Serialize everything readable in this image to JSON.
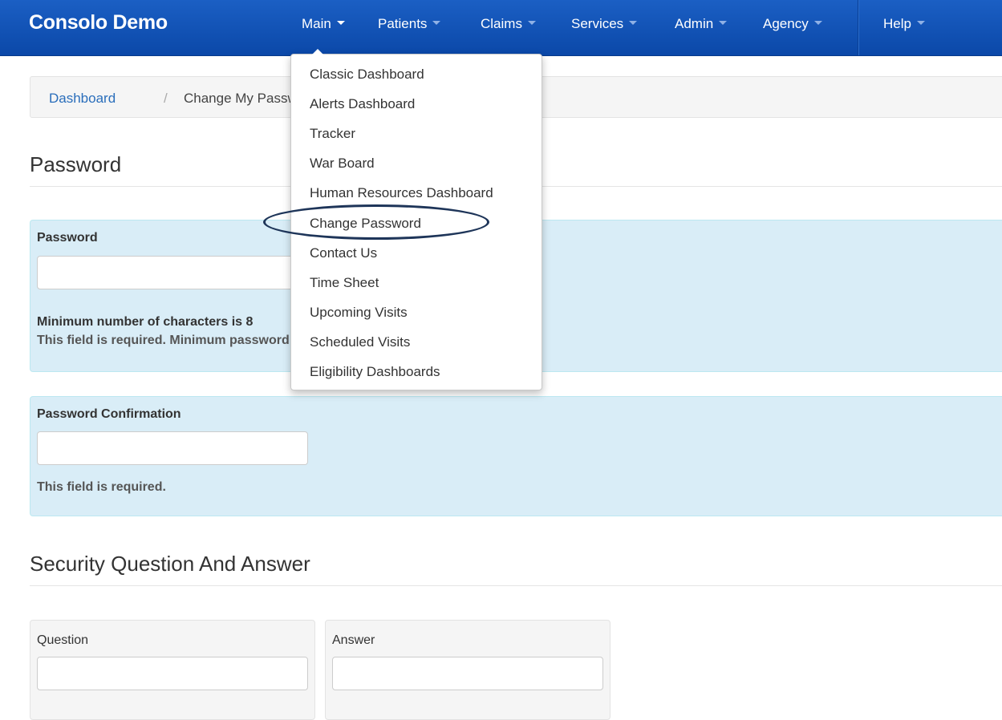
{
  "brand": "Consolo Demo",
  "nav": [
    {
      "label": "Main",
      "active": true
    },
    {
      "label": "Patients"
    },
    {
      "label": "Claims"
    },
    {
      "label": "Services"
    },
    {
      "label": "Admin"
    },
    {
      "label": "Agency"
    },
    {
      "label": "Help"
    }
  ],
  "breadcrumb": {
    "link": "Dashboard",
    "separator": "/",
    "current": "Change My Password"
  },
  "password_section": {
    "title": "Password"
  },
  "password_panel": {
    "label": "Password",
    "help_1": "Minimum number of characters is 8",
    "help_2": "This field is required. Minimum password length is 8 characters."
  },
  "confirmation_panel": {
    "label": "Password Confirmation",
    "help": "This field is required."
  },
  "security_section": {
    "title": "Security Question And Answer",
    "question_label": "Question",
    "answer_label": "Answer"
  },
  "main_menu": {
    "items": [
      "Classic Dashboard",
      "Alerts Dashboard",
      "Tracker",
      "War Board",
      "Human Resources Dashboard",
      "Change Password",
      "Contact Us",
      "Time Sheet",
      "Upcoming Visits",
      "Scheduled Visits",
      "Eligibility Dashboards"
    ],
    "highlighted_item": "Change Password"
  },
  "colors": {
    "navbar": "#1456b8",
    "panel": "#d9edf7",
    "link": "#2a6ebb",
    "ring": "#1e3559"
  }
}
